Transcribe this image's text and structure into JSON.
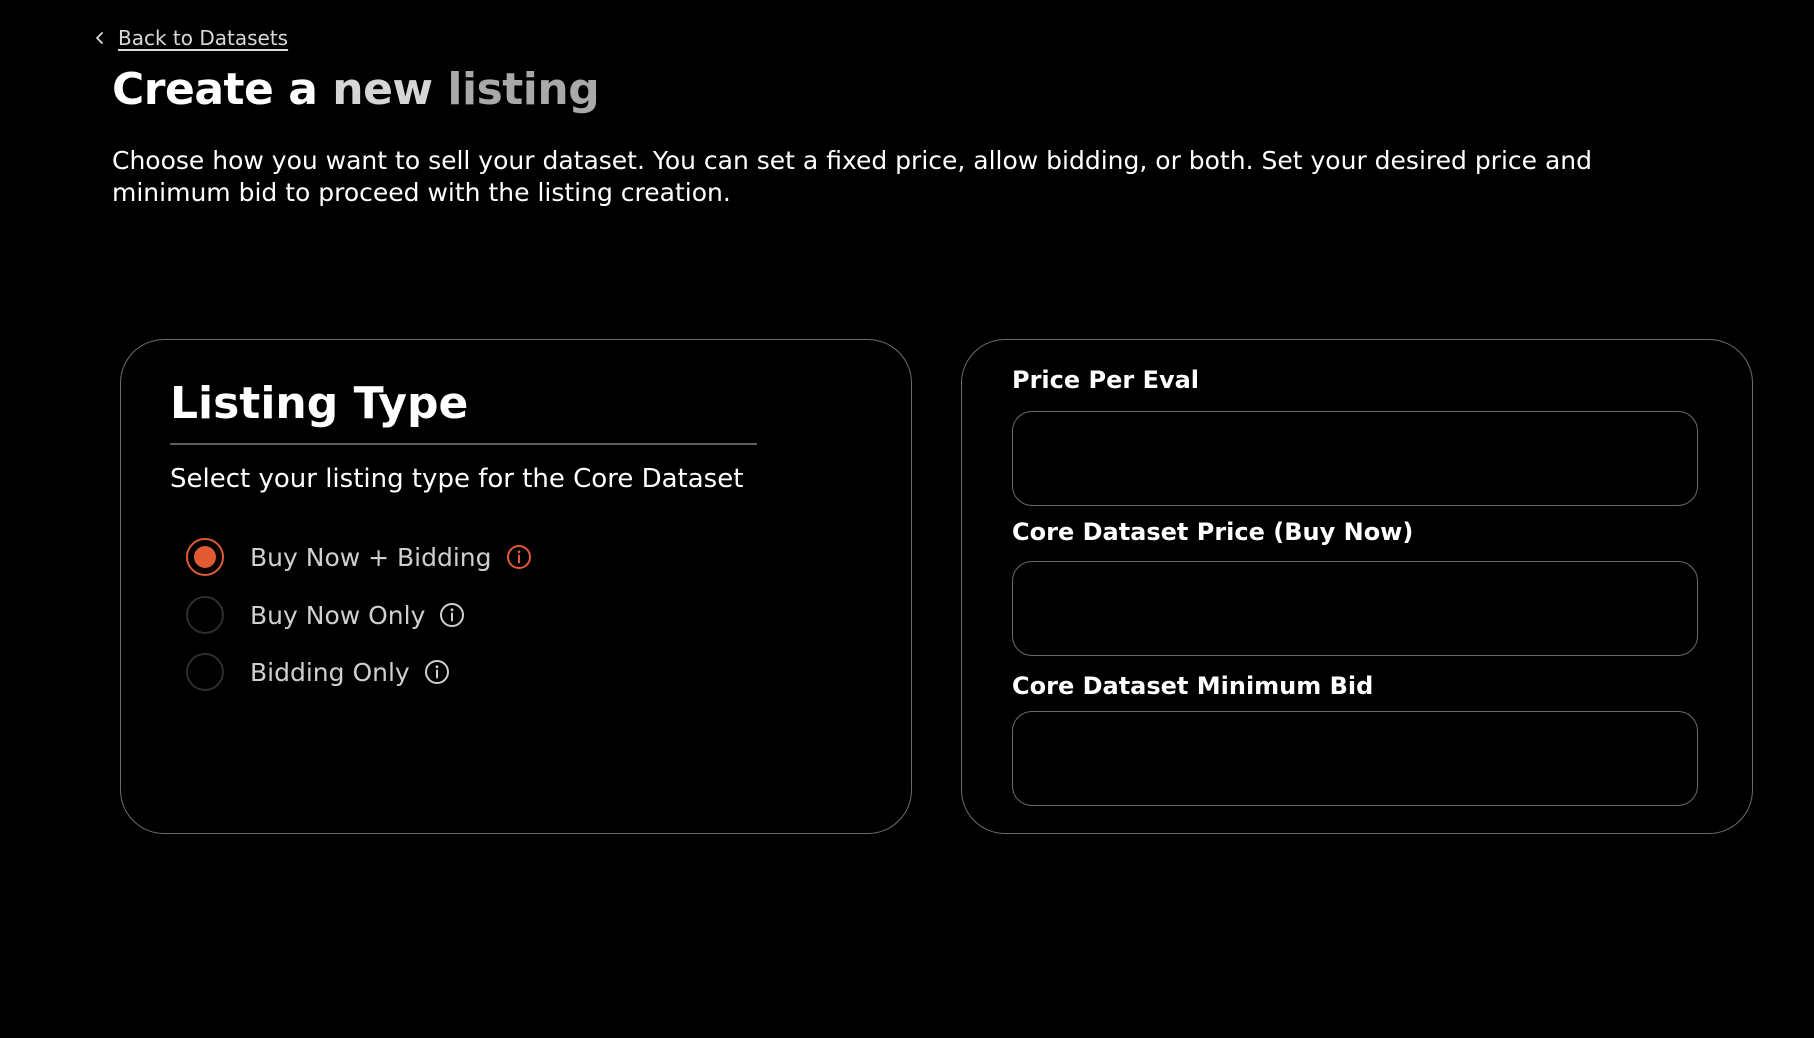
{
  "nav": {
    "back_label": "Back to Datasets",
    "back_icon": "chevron-left-icon"
  },
  "header": {
    "title_part1": "Create a",
    "title_part2": "new",
    "title_part3": "listing",
    "description": "Choose how you want to sell your dataset. You can set a fixed price, allow bidding, or both. Set your desired price and minimum bid to proceed with the listing creation."
  },
  "listing_type": {
    "title": "Listing Type",
    "subtitle": "Select your listing type for the Core Dataset",
    "options": [
      {
        "label": "Buy Now + Bidding",
        "selected": true,
        "icon": "info-icon"
      },
      {
        "label": "Buy Now Only",
        "selected": false,
        "icon": "info-icon"
      },
      {
        "label": "Bidding Only",
        "selected": false,
        "icon": "info-icon"
      }
    ]
  },
  "pricing": {
    "price_per_eval": {
      "label": "Price Per Eval",
      "value": "",
      "placeholder": ""
    },
    "buy_now_price": {
      "label": "Core Dataset Price (Buy Now)",
      "value": "",
      "placeholder": ""
    },
    "minimum_bid": {
      "label": "Core Dataset Minimum Bid",
      "value": "",
      "placeholder": ""
    }
  },
  "colors": {
    "background": "#000000",
    "accent": "#e05a33",
    "border": "#6b6b6b",
    "text": "#ffffff",
    "muted_text": "#cfcfcf"
  }
}
